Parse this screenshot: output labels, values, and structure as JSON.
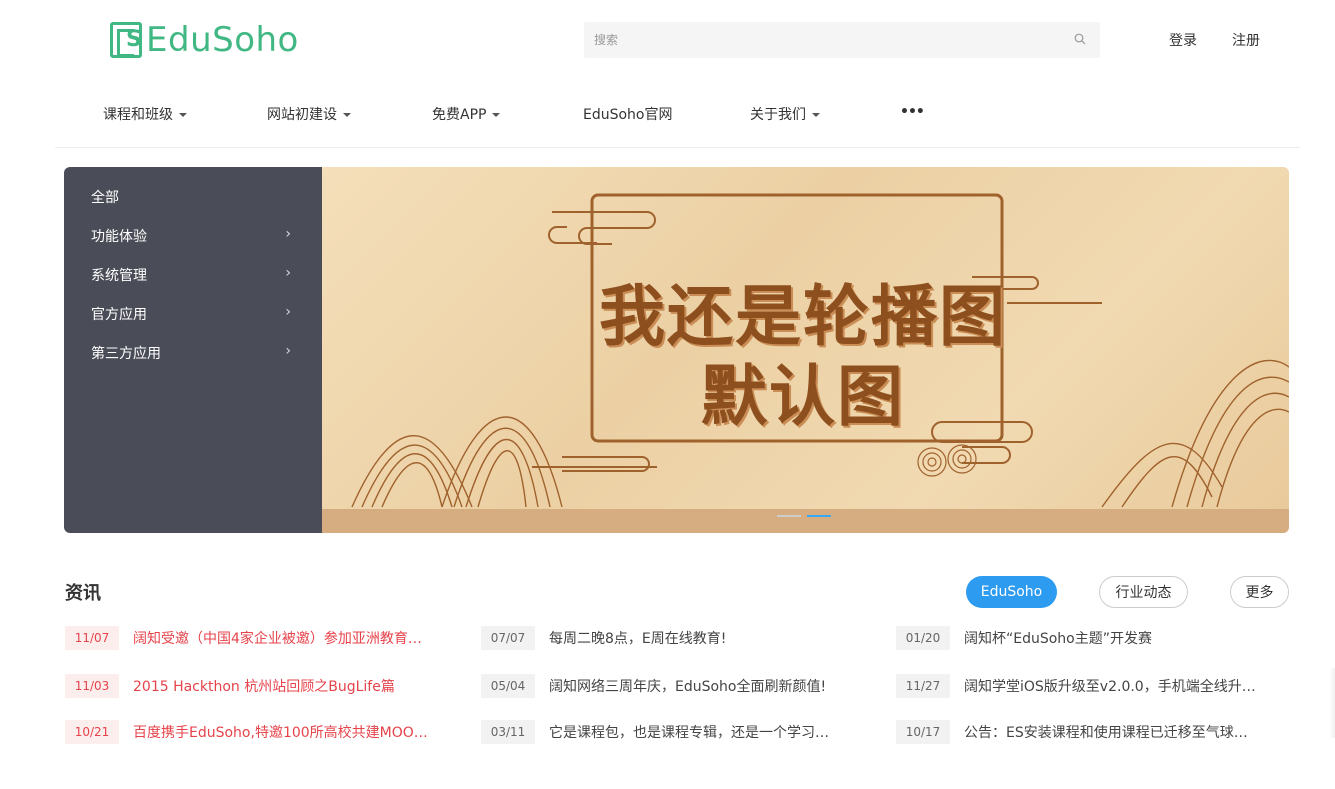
{
  "header": {
    "logo_text": "EduSoho",
    "search_placeholder": "搜索",
    "login": "登录",
    "register": "注册"
  },
  "nav": {
    "items": [
      {
        "label": "课程和班级",
        "dropdown": true
      },
      {
        "label": "网站初建设",
        "dropdown": true
      },
      {
        "label": "免费APP",
        "dropdown": true
      },
      {
        "label": "EduSoho官网",
        "dropdown": false
      },
      {
        "label": "关于我们",
        "dropdown": true
      }
    ],
    "more": "•••"
  },
  "categories": [
    {
      "label": "全部",
      "arrow": ""
    },
    {
      "label": "功能体验",
      "arrow": "›"
    },
    {
      "label": "系统管理",
      "arrow": "›"
    },
    {
      "label": "官方应用",
      "arrow": "›"
    },
    {
      "label": "第三方应用",
      "arrow": "›"
    }
  ],
  "banner": {
    "line1": "我还是轮播图",
    "line2": "默认图"
  },
  "news": {
    "title": "资讯",
    "tabs": [
      {
        "label": "EduSoho",
        "active": true
      },
      {
        "label": "行业动态",
        "active": false
      },
      {
        "label": "更多",
        "active": false
      }
    ],
    "columns": [
      [
        {
          "date": "11/07",
          "text": "阔知受邀（中国4家企业被邀）参加亚洲教育…"
        },
        {
          "date": "11/03",
          "text": "2015 Hackthon 杭州站回顾之BugLife篇"
        },
        {
          "date": "10/21",
          "text": "百度携手EduSoho,特邀100所高校共建MOO…"
        }
      ],
      [
        {
          "date": "07/07",
          "text": "每周二晚8点，E周在线教育!"
        },
        {
          "date": "05/04",
          "text": "阔知网络三周年庆，EduSoho全面刷新颜值!"
        },
        {
          "date": "03/11",
          "text": "它是课程包，也是课程专辑，还是一个学习…"
        }
      ],
      [
        {
          "date": "01/20",
          "text": "阔知杯“EduSoho主题”开发赛"
        },
        {
          "date": "11/27",
          "text": "阔知学堂iOS版升级至v2.0.0，手机端全线升…"
        },
        {
          "date": "10/17",
          "text": "公告：ES安装课程和使用课程已迁移至气球…"
        }
      ]
    ]
  },
  "colors": {
    "brand_green": "#41b883",
    "accent_blue": "#2d9bf0",
    "news_red": "#e6434b",
    "sidebar_bg": "#4a4d57"
  }
}
